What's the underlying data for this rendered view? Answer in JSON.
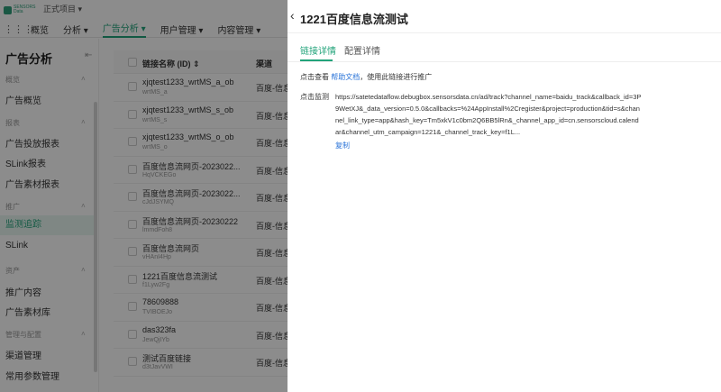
{
  "topbar": {
    "logo_text": "SENSORS Data",
    "project": "正式项目",
    "nav": [
      "概览",
      "分析",
      "广告分析",
      "用户管理",
      "内容管理"
    ]
  },
  "sidebar": {
    "title": "广告分析",
    "groups": [
      {
        "label": "概览",
        "items": [
          "广告概览"
        ]
      },
      {
        "label": "报表",
        "items": [
          "广告投放报表",
          "SLink报表",
          "广告素材报表"
        ]
      },
      {
        "label": "推广",
        "items": [
          "监测追踪",
          "SLink"
        ]
      },
      {
        "label": "资产",
        "items": [
          "推广内容",
          "广告素材库"
        ]
      },
      {
        "label": "管理与配置",
        "items": [
          "渠道管理",
          "常用参数管理"
        ]
      }
    ]
  },
  "table": {
    "col_name": "链接名称 (ID)",
    "col_channel": "渠道",
    "rows": [
      {
        "name": "xjqtest1233_wrtMS_a_ob",
        "id": "wrtMS_a",
        "channel": "百度-信息"
      },
      {
        "name": "xjqtest1233_wrtMS_s_ob",
        "id": "wrtMS_s",
        "channel": "百度-信息"
      },
      {
        "name": "xjqtest1233_wrtMS_o_ob",
        "id": "wrtMS_o",
        "channel": "百度-信息"
      },
      {
        "name": "百度信息流网页-2023022...",
        "id": "HqVCKEGo",
        "channel": "百度-信息"
      },
      {
        "name": "百度信息流网页-2023022...",
        "id": "cJdJSYMQ",
        "channel": "百度-信息"
      },
      {
        "name": "百度信息流网页-20230222",
        "id": "lmmdFoh8",
        "channel": "百度-信息"
      },
      {
        "name": "百度信息流网页",
        "id": "vHAnI4Hp",
        "channel": "百度-信息"
      },
      {
        "name": "1221百度信息流测试",
        "id": "f1Lyw2Fg",
        "channel": "百度-信息"
      },
      {
        "name": "78609888",
        "id": "TVIBOEJo",
        "channel": "百度-信息"
      },
      {
        "name": "das323fa",
        "id": "JewQjIYb",
        "channel": "百度-信息"
      },
      {
        "name": "测试百度链接",
        "id": "d3tJavVWI",
        "channel": "百度-信息"
      }
    ]
  },
  "drawer": {
    "title": "1221百度信息流测试",
    "tabs": [
      "链接详情",
      "配置详情"
    ],
    "intro_prefix": "点击查看",
    "intro_link": "帮助文档",
    "intro_suffix": "，使用此链接进行推广",
    "monitor_label": "点击监测",
    "url": "https://satetedataflow.debugbox.sensorsdata.cn/ad/track?channel_name=baidu_track&callback_id=3P9WetXJ&_data_version=0.5.0&callbacks=%24AppInstall%2Cregister&project=production&tid=s&channel_link_type=app&hash_key=Tm5xkV1c0bm2Q6BB5lRn&_channel_app_id=cn.sensorscloud.calendar&channel_utm_campaign=1221&_channel_track_key=f1L...",
    "copy_label": "复制"
  },
  "colors": {
    "accent": "#21a37a",
    "link": "#2b74d8"
  }
}
